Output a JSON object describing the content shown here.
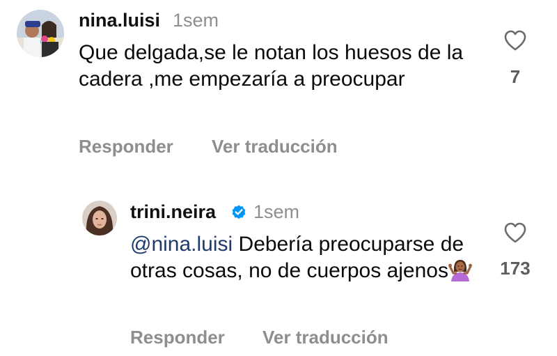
{
  "comment1": {
    "username": "nina.luisi",
    "time": "1sem",
    "text": "Que delgada,se le notan los huesos de la cadera ,me empezaría a preocupar",
    "likes": "7",
    "reply_label": "Responder",
    "translate_label": "Ver traducción",
    "avatar_icon": "profile-photo-group",
    "like_icon": "heart-outline-icon"
  },
  "comment2": {
    "username": "trini.neira",
    "verified_icon": "verified-badge-icon",
    "time": "1sem",
    "mention": "@nina.luisi",
    "text": " Debería preocuparse de otras cosas, no de cuerpos ajenos",
    "emoji_icon": "person-shrugging-emoji",
    "likes": "173",
    "reply_label": "Responder",
    "translate_label": "Ver traducción",
    "avatar_icon": "profile-photo-woman",
    "like_icon": "heart-outline-icon"
  },
  "colors": {
    "secondary_text": "#8e8e8e",
    "mention": "#1f3b6b",
    "verified": "#0095f6",
    "like_count": "#5e5e5e"
  }
}
